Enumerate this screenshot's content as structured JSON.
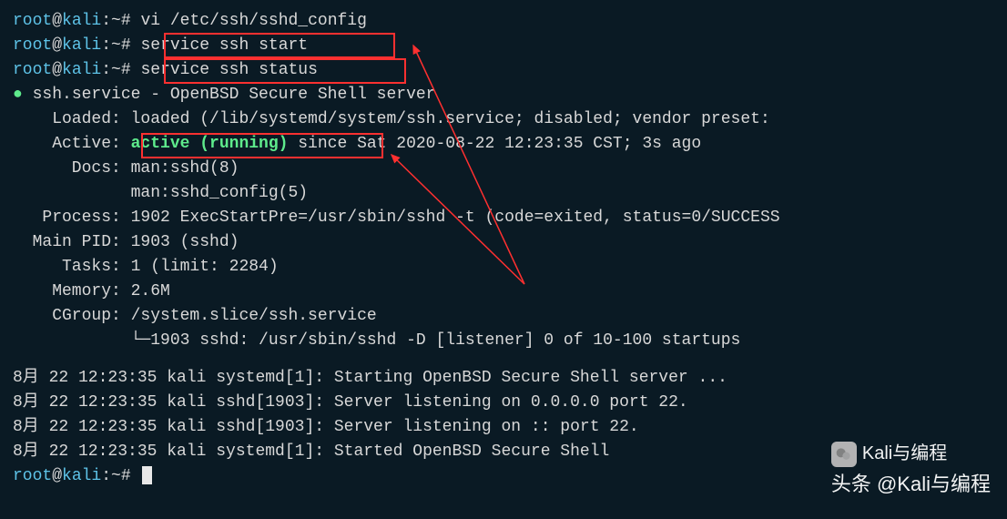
{
  "prompt": {
    "user": "root",
    "at": "@",
    "host": "kali",
    "path": ":~",
    "hash": "# "
  },
  "lines": {
    "cmd1": "vi /etc/ssh/sshd_config",
    "cmd2": "service ssh start",
    "cmd3": "service ssh status",
    "svc_header": "ssh.service - OpenBSD Secure Shell server",
    "loaded_label": "    Loaded: ",
    "loaded_val": "loaded (/lib/systemd/system/ssh.service; disabled; vendor preset:",
    "active_label": "    Active: ",
    "active_status": "active (running)",
    "active_rest": " since Sat 2020-08-22 12:23:35 CST; 3s ago",
    "docs_label": "      Docs: ",
    "docs1": "man:sshd(8)",
    "docs2": "            man:sshd_config(5)",
    "process_label": "   Process: ",
    "process_val": "1902 ExecStartPre=/usr/sbin/sshd -t (code=exited, status=0/SUCCESS",
    "mainpid_label": "  Main PID: ",
    "mainpid_val": "1903 (sshd)",
    "tasks_label": "     Tasks: ",
    "tasks_val": "1 (limit: 2284)",
    "memory_label": "    Memory: ",
    "memory_val": "2.6M",
    "cgroup_label": "    CGroup: ",
    "cgroup_val": "/system.slice/ssh.service",
    "cgroup_tree": "            └─1903 sshd: /usr/sbin/sshd -D [listener] 0 of 10-100 startups",
    "log1": "8月 22 12:23:35 kali systemd[1]: Starting OpenBSD Secure Shell server ...",
    "log2": "8月 22 12:23:35 kali sshd[1903]: Server listening on 0.0.0.0 port 22.",
    "log3": "8月 22 12:23:35 kali sshd[1903]: Server listening on :: port 22.",
    "log4": "8月 22 12:23:35 kali systemd[1]: Started OpenBSD Secure Shell "
  },
  "watermark": {
    "line1": "Kali与编程",
    "line2": "头条 @Kali与编程"
  }
}
